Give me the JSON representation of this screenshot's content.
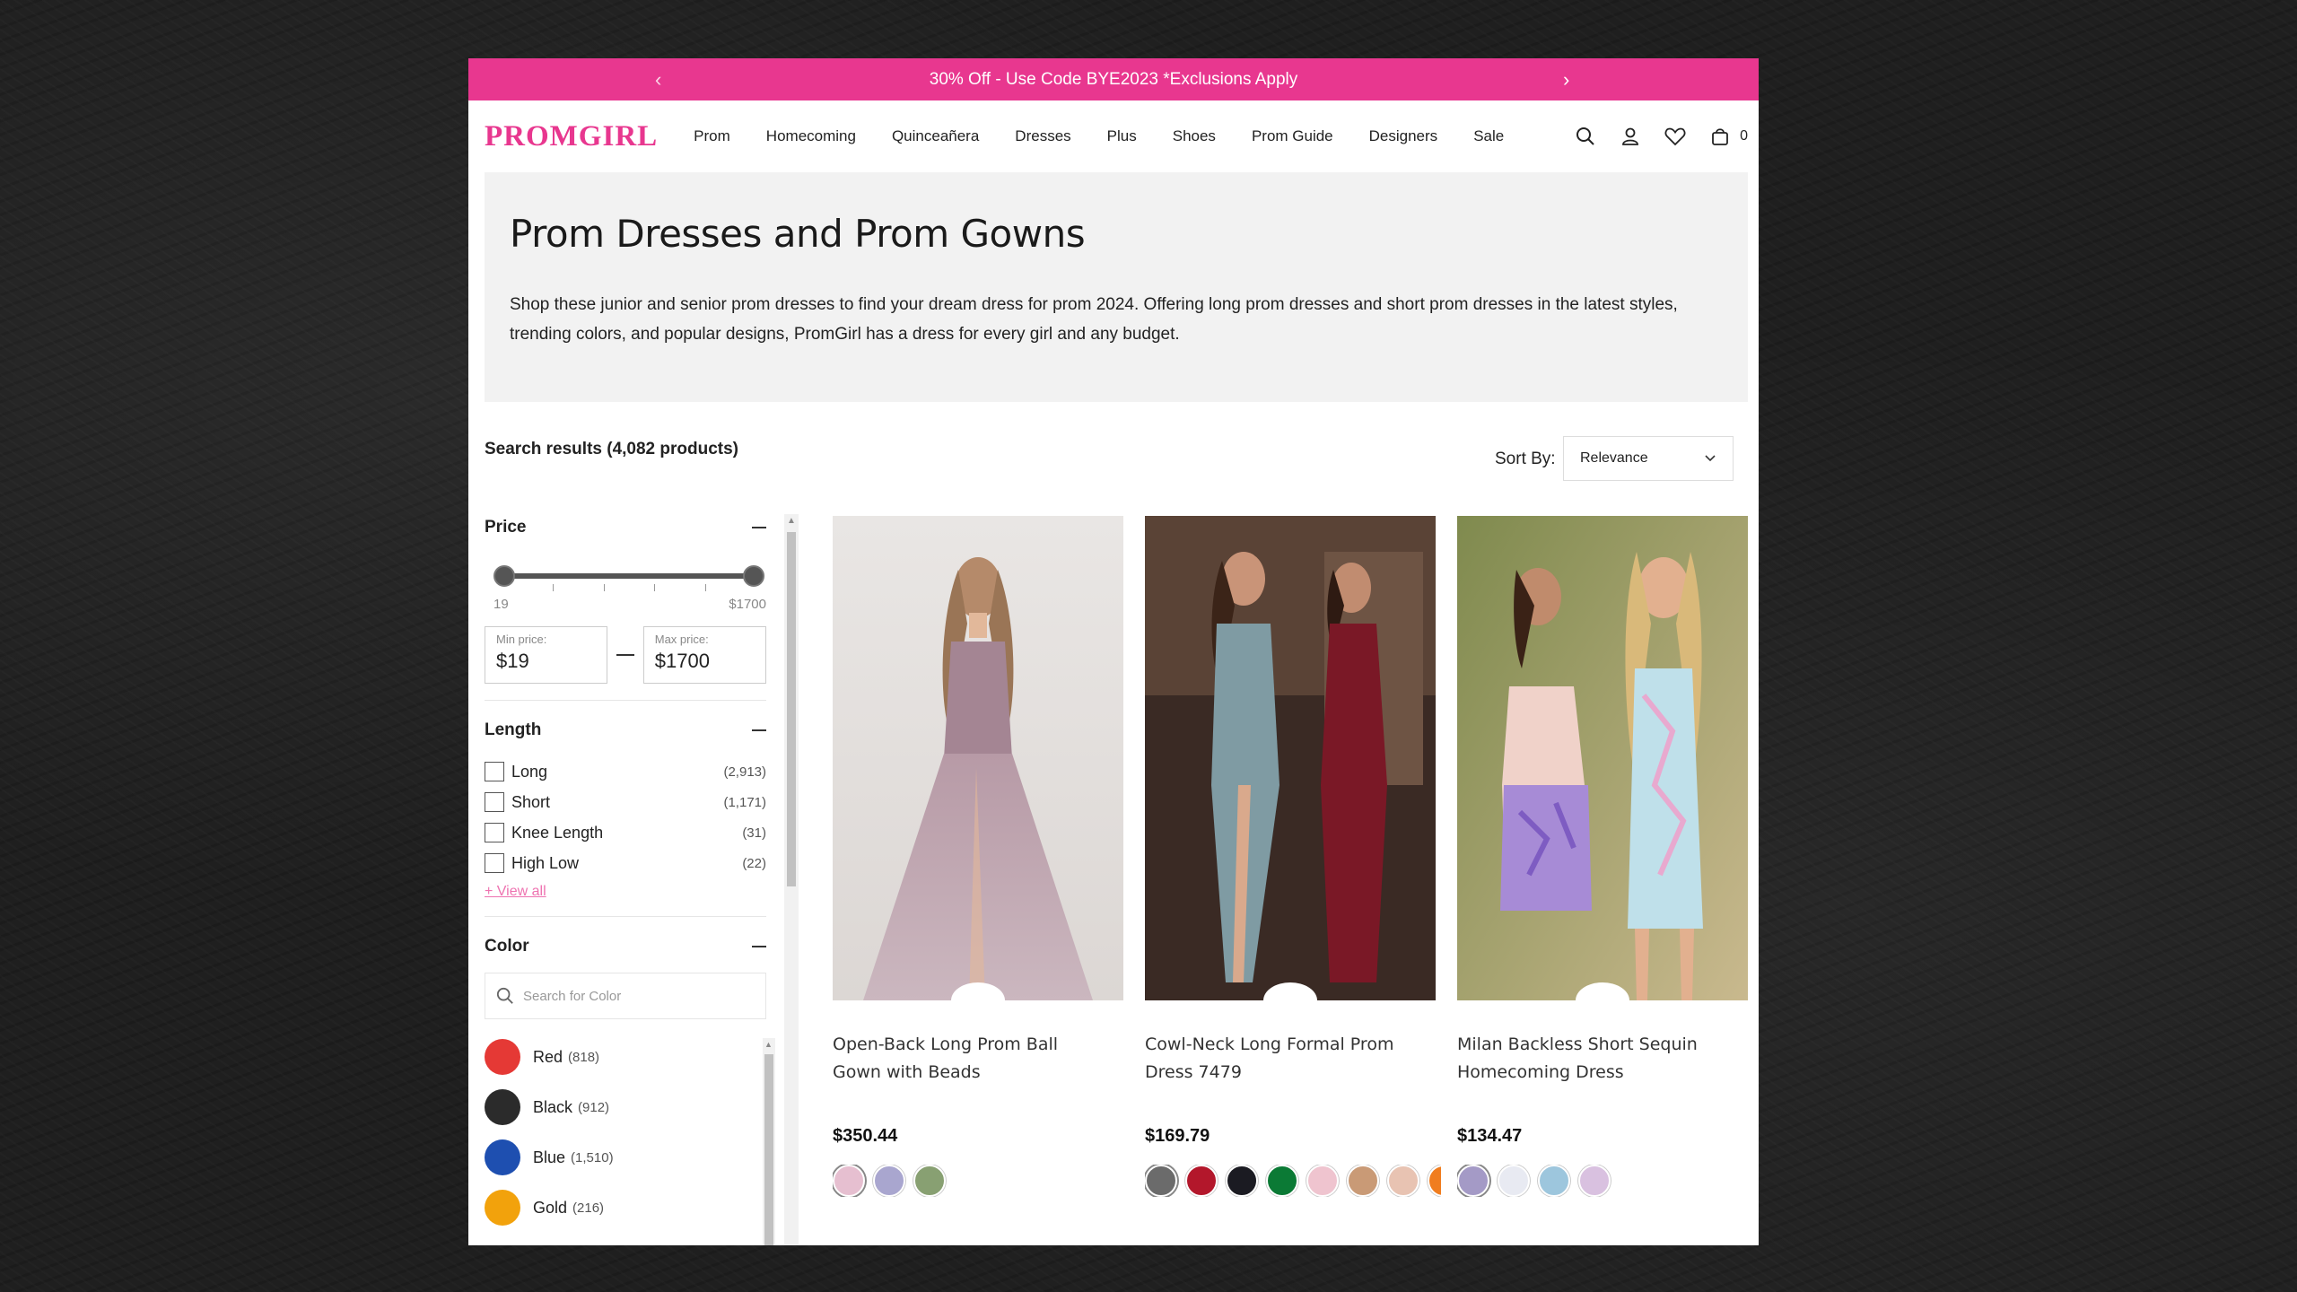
{
  "promo": {
    "text": "30% Off - Use Code BYE2023 *Exclusions Apply",
    "prev_icon": "chevron-left-icon",
    "next_icon": "chevron-right-icon"
  },
  "header": {
    "logo": "PROMGIRL",
    "nav": [
      "Prom",
      "Homecoming",
      "Quinceañera",
      "Dresses",
      "Plus",
      "Shoes",
      "Prom Guide",
      "Designers",
      "Sale"
    ],
    "cart_count": "0",
    "icons": [
      "search-icon",
      "account-icon",
      "heart-icon",
      "cart-icon"
    ]
  },
  "hero": {
    "title": "Prom Dresses and Prom Gowns",
    "description": "Shop these junior and senior prom dresses to find your dream dress for prom 2024. Offering long prom dresses and short prom dresses in the latest styles, trending colors, and popular designs, PromGirl has a dress for every girl and any budget."
  },
  "results": {
    "count_text": "Search results (4,082 products)",
    "sort_label": "Sort By:",
    "sort_value": "Relevance"
  },
  "filters": {
    "price": {
      "title": "Price",
      "min_tick": "19",
      "max_tick": "$1700",
      "min_label": "Min price:",
      "min_value": "$19",
      "max_label": "Max price:",
      "max_value": "$1700"
    },
    "length": {
      "title": "Length",
      "options": [
        {
          "name": "Long",
          "count": "(2,913)"
        },
        {
          "name": "Short",
          "count": "(1,171)"
        },
        {
          "name": "Knee Length",
          "count": "(31)"
        },
        {
          "name": "High Low",
          "count": "(22)"
        }
      ],
      "view_all": "+ View all"
    },
    "color": {
      "title": "Color",
      "search_placeholder": "Search for Color",
      "options": [
        {
          "name": "Red",
          "count": "(818)",
          "hex": "#e53935"
        },
        {
          "name": "Black",
          "count": "(912)",
          "hex": "#2b2b2b"
        },
        {
          "name": "Blue",
          "count": "(1,510)",
          "hex": "#1e4fb0"
        },
        {
          "name": "Gold",
          "count": "(216)",
          "hex": "#f2a20c"
        }
      ]
    }
  },
  "products": [
    {
      "name": "Open-Back Long Prom Ball Gown with Beads",
      "price": "$350.44",
      "swatches": [
        "#e6bfd0",
        "#a9a6cf",
        "#88a072"
      ]
    },
    {
      "name": "Cowl-Neck Long Formal Prom Dress 7479",
      "price": "$169.79",
      "swatches": [
        "#6b6b6b",
        "#b3172b",
        "#1b1b22",
        "#0b7a35",
        "#efc4cf",
        "#c99a76",
        "#e8c3b2",
        "#f07d1f"
      ]
    },
    {
      "name": "Milan Backless Short Sequin Homecoming Dress",
      "price": "$134.47",
      "swatches": [
        "#a49ac6",
        "#e8eaf2",
        "#9dc6dd",
        "#d9c1e0"
      ]
    }
  ],
  "colors": {
    "accent": "#e8378f"
  }
}
